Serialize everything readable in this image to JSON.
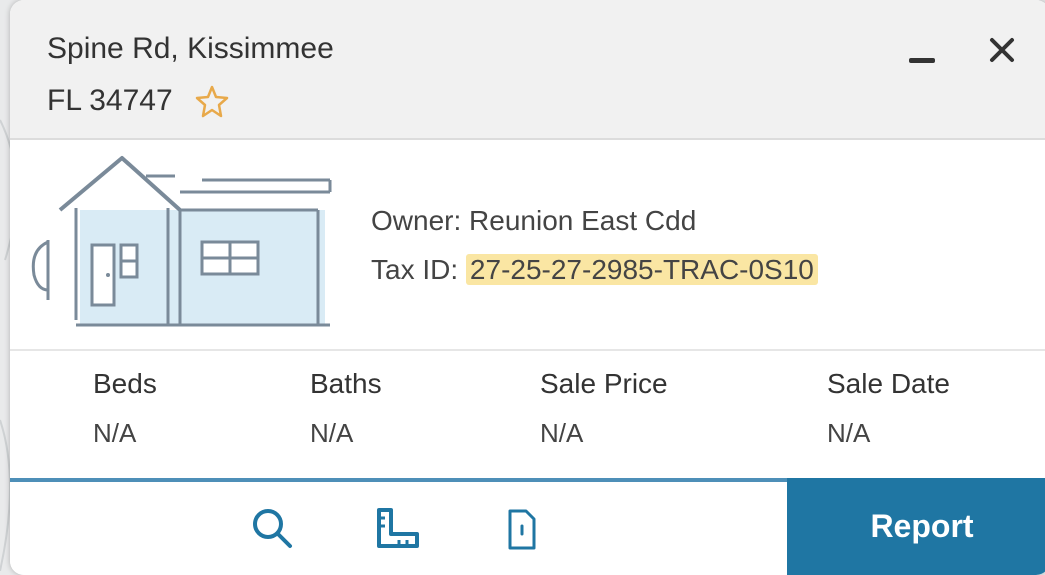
{
  "header": {
    "address_line1": "Spine Rd, Kissimmee",
    "address_line2": "FL 34747",
    "favorite_icon": "star-outline-icon",
    "minimize_icon": "minimize-icon",
    "close_icon": "close-icon"
  },
  "property": {
    "owner_label": "Owner:",
    "owner_value": "Reunion East Cdd",
    "tax_label": "Tax ID:",
    "tax_value": "27-25-27-2985-TRAC-0S10"
  },
  "stats": [
    {
      "label": "Beds",
      "value": "N/A"
    },
    {
      "label": "Baths",
      "value": "N/A"
    },
    {
      "label": "Sale Price",
      "value": "N/A"
    },
    {
      "label": "Sale Date",
      "value": "N/A"
    }
  ],
  "footer": {
    "tools": [
      "search-icon",
      "ruler-icon",
      "document-icon"
    ],
    "report_label": "Report"
  },
  "colors": {
    "accent": "#1f76a3",
    "highlight": "#fae6a3",
    "star": "#e8a94a"
  }
}
